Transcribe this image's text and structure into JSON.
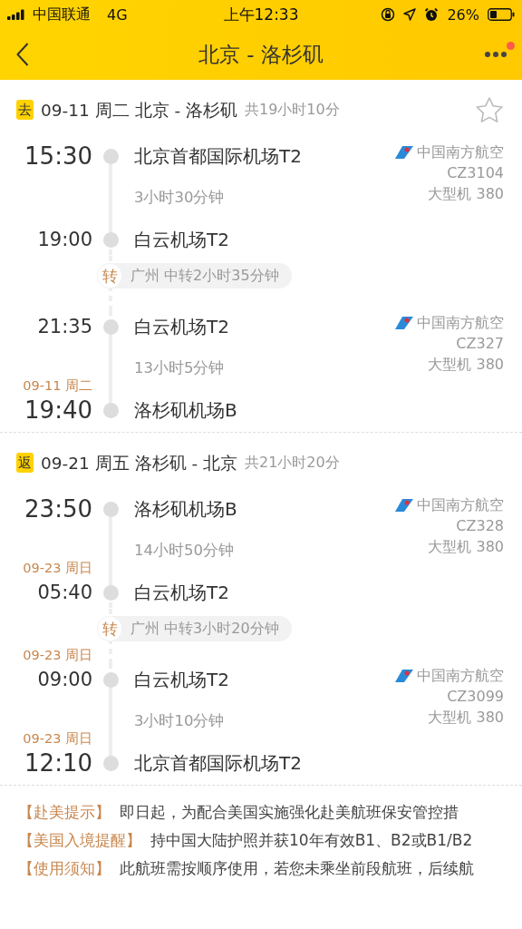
{
  "status_bar": {
    "carrier": "中国联通",
    "network": "4G",
    "time": "上午12:33",
    "battery": "26%"
  },
  "nav": {
    "title": "北京 - 洛杉矶",
    "notification": true
  },
  "journeys": [
    {
      "badge": "去",
      "date": "09-11 周二",
      "route": "北京 - 洛杉矶",
      "total": "共19小时10分",
      "starred": false,
      "items": [
        {
          "kind": "leg",
          "dep": {
            "time": "15:30",
            "airport": "北京首都国际机场T2"
          },
          "duration": "3小时30分钟",
          "arr": {
            "time": "19:00",
            "airport": "白云机场T2"
          },
          "airline": "中国南方航空",
          "flight": "CZ3104",
          "aircraft": "大型机 380"
        },
        {
          "kind": "transfer",
          "badge": "转",
          "text": "广州 中转2小时35分钟"
        },
        {
          "kind": "leg",
          "dep": {
            "time": "21:35",
            "airport": "白云机场T2"
          },
          "duration": "13小时5分钟",
          "arr": {
            "date": "09-11 周二",
            "time": "19:40",
            "airport": "洛杉矶机场B"
          },
          "airline": "中国南方航空",
          "flight": "CZ327",
          "aircraft": "大型机 380"
        }
      ]
    },
    {
      "badge": "返",
      "date": "09-21 周五",
      "route": "洛杉矶 - 北京",
      "total": "共21小时20分",
      "items": [
        {
          "kind": "leg",
          "dep": {
            "time": "23:50",
            "airport": "洛杉矶机场B"
          },
          "duration": "14小时50分钟",
          "arr": {
            "date": "09-23 周日",
            "time": "05:40",
            "airport": "白云机场T2"
          },
          "airline": "中国南方航空",
          "flight": "CZ328",
          "aircraft": "大型机 380"
        },
        {
          "kind": "transfer",
          "badge": "转",
          "text": "广州 中转3小时20分钟"
        },
        {
          "kind": "leg",
          "dep": {
            "date": "09-23 周日",
            "time": "09:00",
            "airport": "白云机场T2"
          },
          "duration": "3小时10分钟",
          "arr": {
            "date": "09-23 周日",
            "time": "12:10",
            "airport": "北京首都国际机场T2"
          },
          "airline": "中国南方航空",
          "flight": "CZ3099",
          "aircraft": "大型机 380"
        }
      ]
    }
  ],
  "notes": [
    {
      "label": "【赴美提示】",
      "text": "即日起，为配合美国实施强化赴美航班保安管控措"
    },
    {
      "label": "【美国入境提醒】",
      "text": "持中国大陆护照并获10年有效B1、B2或B1/B2"
    },
    {
      "label": "【使用须知】",
      "text": "此航班需按顺序使用，若您未乘坐前段航班，后续航"
    }
  ]
}
